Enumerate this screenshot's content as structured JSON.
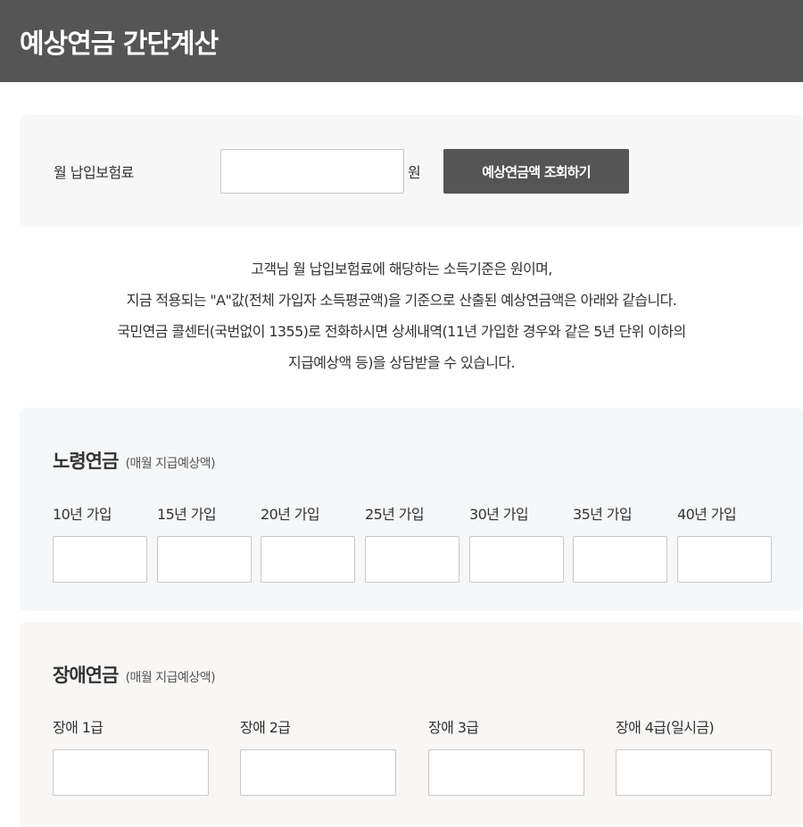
{
  "page_title": "예상연금 간단계산",
  "premium_section": {
    "label": "월 납입보험료",
    "input_value": "",
    "unit": "원",
    "button_label": "예상연금액 조회하기"
  },
  "description": [
    "고객님 월 납입보험료에 해당하는 소득기준은 원이며,",
    "지금 적용되는 \"A\"값(전체 가입자 소득평균액)을 기준으로 산출된 예상연금액은 아래와 같습니다.",
    "국민연금 콜센터(국번없이 1355)로 전화하시면 상세내역(11년 가입한 경우와 같은 5년 단위 이하의",
    "지급예상액 등)을 상담받을 수 있습니다."
  ],
  "aging_pension": {
    "title": "노령연금",
    "subtitle": "(매월 지급예상액)",
    "items": [
      {
        "label": "10년 가입",
        "value": ""
      },
      {
        "label": "15년 가입",
        "value": ""
      },
      {
        "label": "20년 가입",
        "value": ""
      },
      {
        "label": "25년 가입",
        "value": ""
      },
      {
        "label": "30년 가입",
        "value": ""
      },
      {
        "label": "35년 가입",
        "value": ""
      },
      {
        "label": "40년 가입",
        "value": ""
      }
    ]
  },
  "disability_pension": {
    "title": "장애연금",
    "subtitle": "(매월 지급예상액)",
    "items": [
      {
        "label": "장애 1급",
        "value": ""
      },
      {
        "label": "장애 2급",
        "value": ""
      },
      {
        "label": "장애 3급",
        "value": ""
      },
      {
        "label": "장애 4급(일시금)",
        "value": ""
      }
    ]
  },
  "colors": {
    "header_bg": "#555555",
    "button_bg": "#555555",
    "panel_bg": "#f7f7f7"
  }
}
